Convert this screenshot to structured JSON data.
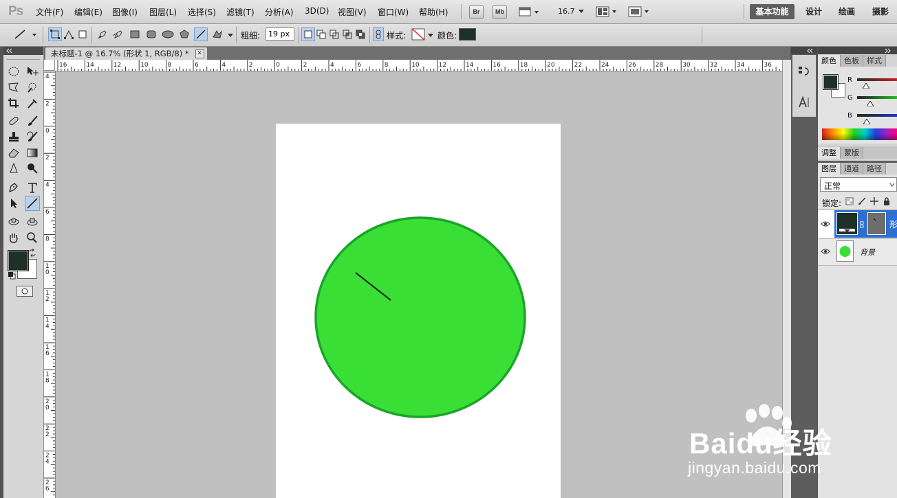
{
  "app": {
    "logo": "Ps"
  },
  "menu": [
    "文件(F)",
    "编辑(E)",
    "图像(I)",
    "图层(L)",
    "选择(S)",
    "滤镜(T)",
    "分析(A)",
    "3D(D)",
    "视图(V)",
    "窗口(W)",
    "帮助(H)"
  ],
  "appbar": {
    "bridge": "Br",
    "minibridge": "Mb",
    "zoom": "16.7"
  },
  "workspaces": [
    "基本功能",
    "设计",
    "绘画",
    "摄影"
  ],
  "options": {
    "weight_label": "粗细:",
    "weight_value": "19 px",
    "style_label": "样式:",
    "color_label": "颜色:",
    "fill_color": "#1f3028"
  },
  "document": {
    "tab_title": "未标题-1 @ 16.7% (形状 1, RGB/8) *",
    "close_glyph": "✕",
    "hruler_labels": [
      "16",
      "14",
      "12",
      "10",
      "8",
      "6",
      "4",
      "2",
      "0",
      "2",
      "4",
      "6",
      "8",
      "10",
      "12",
      "14",
      "16",
      "18",
      "20",
      "22",
      "24",
      "26",
      "28",
      "30",
      "32",
      "34",
      "36"
    ],
    "vruler_labels": [
      "4",
      "2",
      "0",
      "2",
      "4",
      "6",
      "8",
      "10",
      "12",
      "14",
      "16",
      "18",
      "20",
      "22",
      "24",
      "26"
    ],
    "circle_fill": "#3adf35",
    "circle_stroke": "#1aa52a",
    "line_color": "#1e2a20"
  },
  "tools": {
    "foreground": "#1f3028",
    "background": "#ffffff"
  },
  "panels": {
    "color_tabs": [
      "颜色",
      "色板",
      "样式"
    ],
    "channels": [
      "R",
      "G",
      "B"
    ],
    "adjust_tabs": [
      "调整",
      "蒙版"
    ],
    "layer_tabs": [
      "图层",
      "通道",
      "路径"
    ],
    "blend_mode": "正常",
    "lock_label": "锁定:",
    "layers": [
      {
        "name": "形",
        "selected": true
      },
      {
        "name": "背景",
        "selected": false
      }
    ]
  },
  "watermark": {
    "brand": "Baidu经验",
    "url": "jingyan.baidu.com"
  }
}
